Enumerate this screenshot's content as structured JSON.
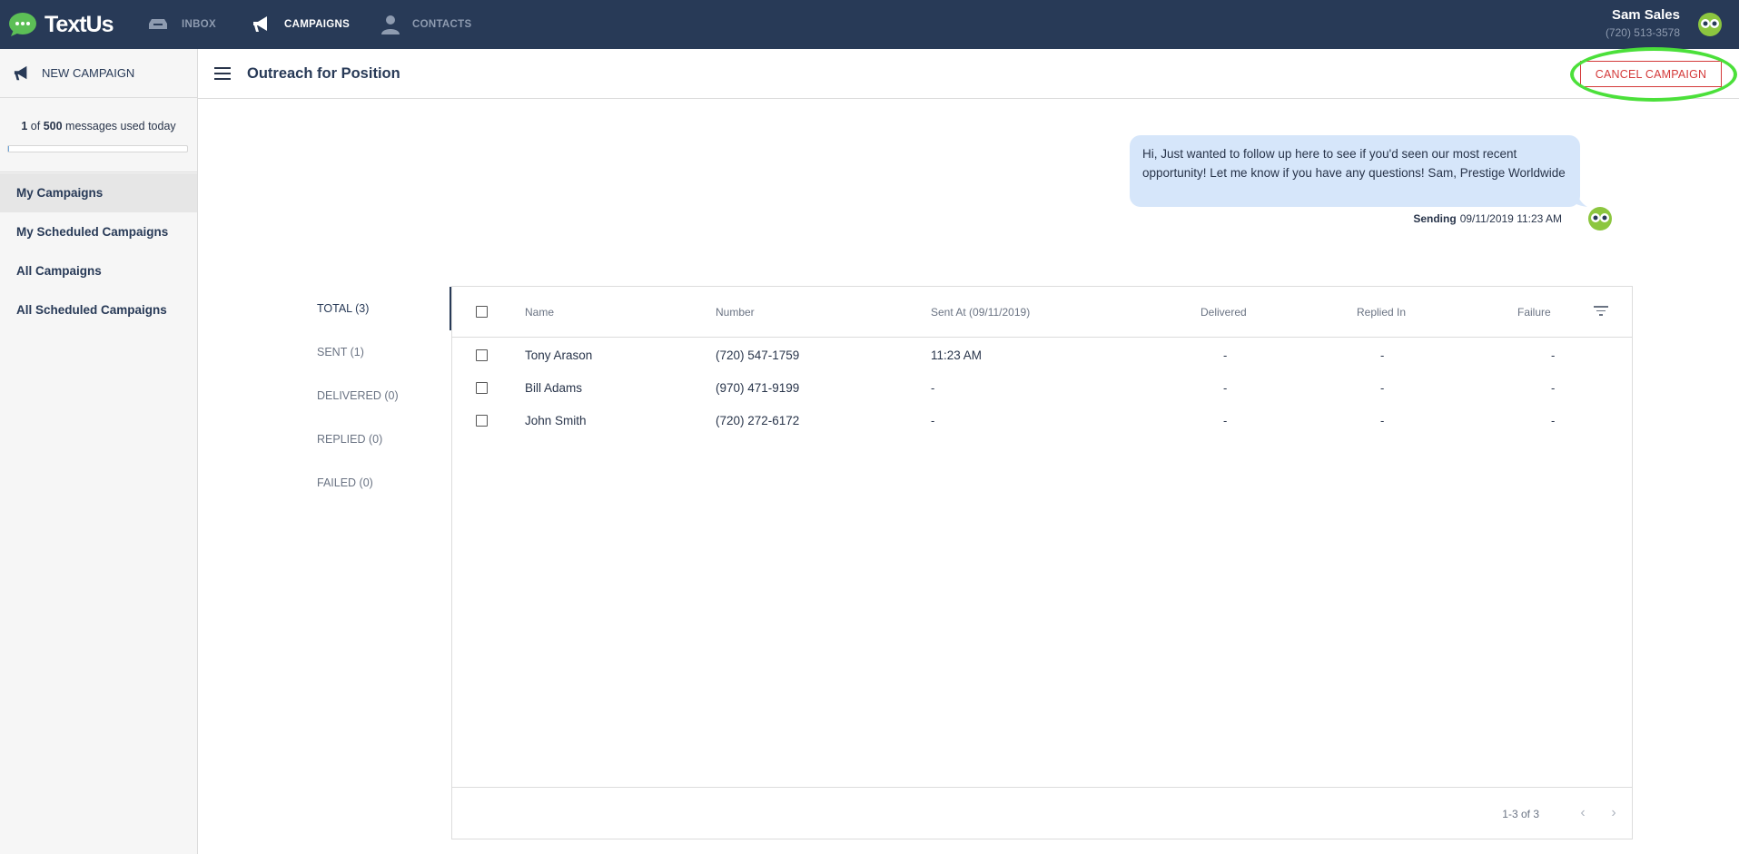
{
  "topnav": {
    "logo_text": "TextUs",
    "items": [
      {
        "label": "INBOX",
        "icon": "inbox-icon",
        "active": false
      },
      {
        "label": "CAMPAIGNS",
        "icon": "megaphone-icon",
        "active": true
      },
      {
        "label": "CONTACTS",
        "icon": "contact-person-icon",
        "active": false
      }
    ],
    "user": {
      "name": "Sam Sales",
      "phone": "(720) 513-3578"
    }
  },
  "sidebar": {
    "new_campaign_label": "NEW CAMPAIGN",
    "usage": {
      "used": "1",
      "of_label": "of",
      "limit": "500",
      "suffix": "messages used today",
      "fraction": 0.002
    },
    "items": [
      {
        "label": "My Campaigns",
        "active": true
      },
      {
        "label": "My Scheduled Campaigns",
        "active": false
      },
      {
        "label": "All Campaigns",
        "active": false
      },
      {
        "label": "All Scheduled Campaigns",
        "active": false
      }
    ]
  },
  "header": {
    "title": "Outreach for Position",
    "cancel_label": "CANCEL CAMPAIGN"
  },
  "message": {
    "text": "Hi, Just wanted to follow up here to see if you'd seen our most recent opportunity! Let me know if you have any questions! Sam, Prestige Worldwide",
    "status": "Sending",
    "timestamp": "09/11/2019 11:23 AM"
  },
  "filters": [
    {
      "label": "TOTAL (3)",
      "active": true
    },
    {
      "label": "SENT (1)",
      "active": false
    },
    {
      "label": "DELIVERED (0)",
      "active": false
    },
    {
      "label": "REPLIED (0)",
      "active": false
    },
    {
      "label": "FAILED (0)",
      "active": false
    }
  ],
  "table": {
    "columns": {
      "name": "Name",
      "number": "Number",
      "sent_at": "Sent At (09/11/2019)",
      "delivered": "Delivered",
      "replied": "Replied In",
      "failure": "Failure"
    },
    "rows": [
      {
        "name": "Tony Arason",
        "number": "(720) 547-1759",
        "sent_at": "11:23 AM",
        "delivered": "-",
        "replied": "-",
        "failure": "-"
      },
      {
        "name": "Bill Adams",
        "number": "(970) 471-9199",
        "sent_at": "-",
        "delivered": "-",
        "replied": "-",
        "failure": "-"
      },
      {
        "name": "John Smith",
        "number": "(720) 272-6172",
        "sent_at": "-",
        "delivered": "-",
        "replied": "-",
        "failure": "-"
      }
    ],
    "pagination": "1-3 of 3"
  },
  "colors": {
    "nav_bg": "#283a57",
    "accent_red": "#d43a3a",
    "highlight_green": "#4be03a",
    "bubble_bg": "#d6e6fa"
  }
}
